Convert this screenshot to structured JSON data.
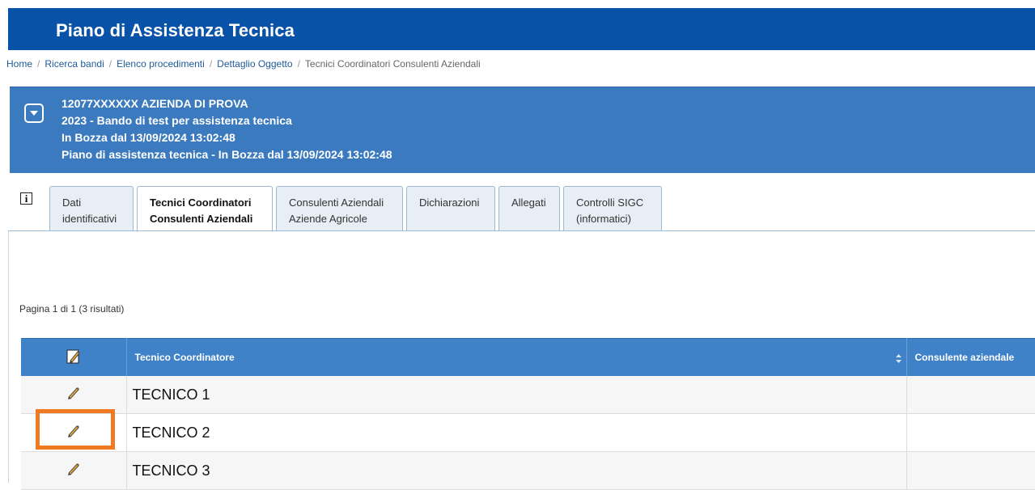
{
  "header": {
    "title": "Piano di Assistenza Tecnica",
    "bg_color": "#0853a7"
  },
  "breadcrumb": {
    "items": [
      "Home",
      "Ricerca bandi",
      "Elenco procedimenti",
      "Dettaglio Oggetto"
    ],
    "current": "Tecnici Coordinatori Consulenti Aziendali"
  },
  "info_box": {
    "bg_color": "#3b7abe",
    "toggle_icon": "chevron-down-icon",
    "lines": [
      "12077XXXXXX AZIENDA DI PROVA",
      "2023 - Bando di test per assistenza tecnica",
      "In Bozza dal 13/09/2024 13:02:48",
      "Piano di assistenza tecnica - In Bozza dal 13/09/2024 13:02:48"
    ]
  },
  "info_icon": {
    "symbol": "i",
    "name": "info-icon"
  },
  "tabs": [
    {
      "line1": "Dati",
      "line2": "identificativi"
    },
    {
      "line1": "Tecnici Coordinatori",
      "line2": "Consulenti Aziendali",
      "active": true
    },
    {
      "line1": "Consulenti Aziendali",
      "line2": "Aziende Agricole"
    },
    {
      "line1": "Dichiarazioni",
      "line2": ""
    },
    {
      "line1": "Allegati",
      "line2": ""
    },
    {
      "line1": "Controlli SIGC",
      "line2": "(informatici)"
    }
  ],
  "pagination": {
    "text": "Pagina 1 di 1 (3 risultati)"
  },
  "table": {
    "header_icon": "edit-pencil-icon",
    "columns": [
      "Tecnico Coordinatore",
      "Consulente aziendale"
    ],
    "rows": [
      {
        "tecnico": "TECNICO 1",
        "consulente": ""
      },
      {
        "tecnico": "TECNICO 2",
        "consulente": ""
      },
      {
        "tecnico": "TECNICO 3",
        "consulente": ""
      }
    ],
    "header_color": "#3f82c8"
  },
  "highlight": {
    "row": "TECNICO 2",
    "color": "#f07a22"
  }
}
